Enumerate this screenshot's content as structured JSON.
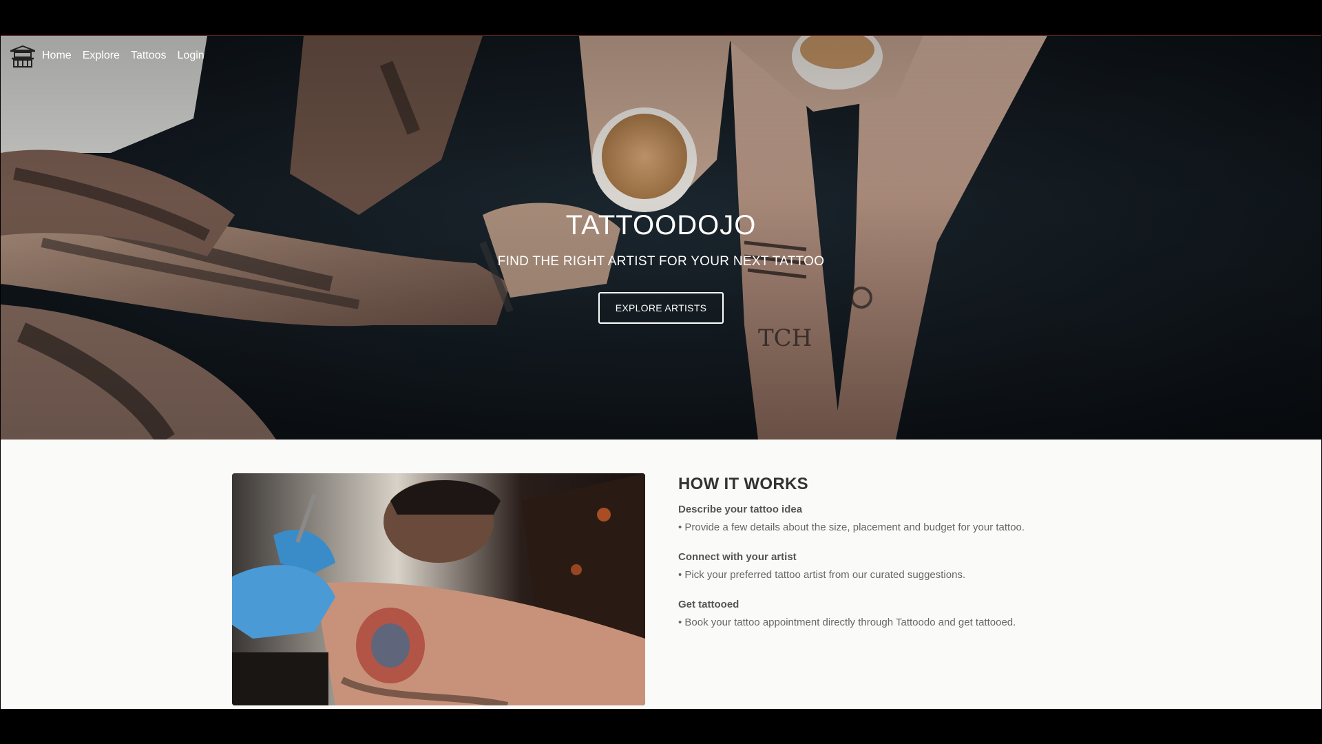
{
  "nav": {
    "logo_icon": "pagoda-logo-icon",
    "links": [
      {
        "label": "Home"
      },
      {
        "label": "Explore"
      },
      {
        "label": "Tattoos"
      },
      {
        "label": "Login"
      }
    ]
  },
  "hero": {
    "title": "TATTOODOJO",
    "subtitle": "FIND THE RIGHT ARTIST FOR YOUR NEXT TATTOO",
    "button_label": "EXPLORE ARTISTS"
  },
  "how_it_works": {
    "title": "HOW IT WORKS",
    "steps": [
      {
        "title": "Describe your tattoo idea",
        "description": "• Provide a few details about the size, placement and budget for your tattoo."
      },
      {
        "title": "Connect with your artist",
        "description": "• Pick your preferred tattoo artist from our curated suggestions."
      },
      {
        "title": "Get tattooed",
        "description": "• Book your tattoo appointment directly through Tattoodo and get tattooed."
      }
    ]
  },
  "colors": {
    "page_background": "#fafaf9",
    "outer_background": "#000000",
    "hero_text": "#ffffff",
    "heading_text": "#333333"
  }
}
